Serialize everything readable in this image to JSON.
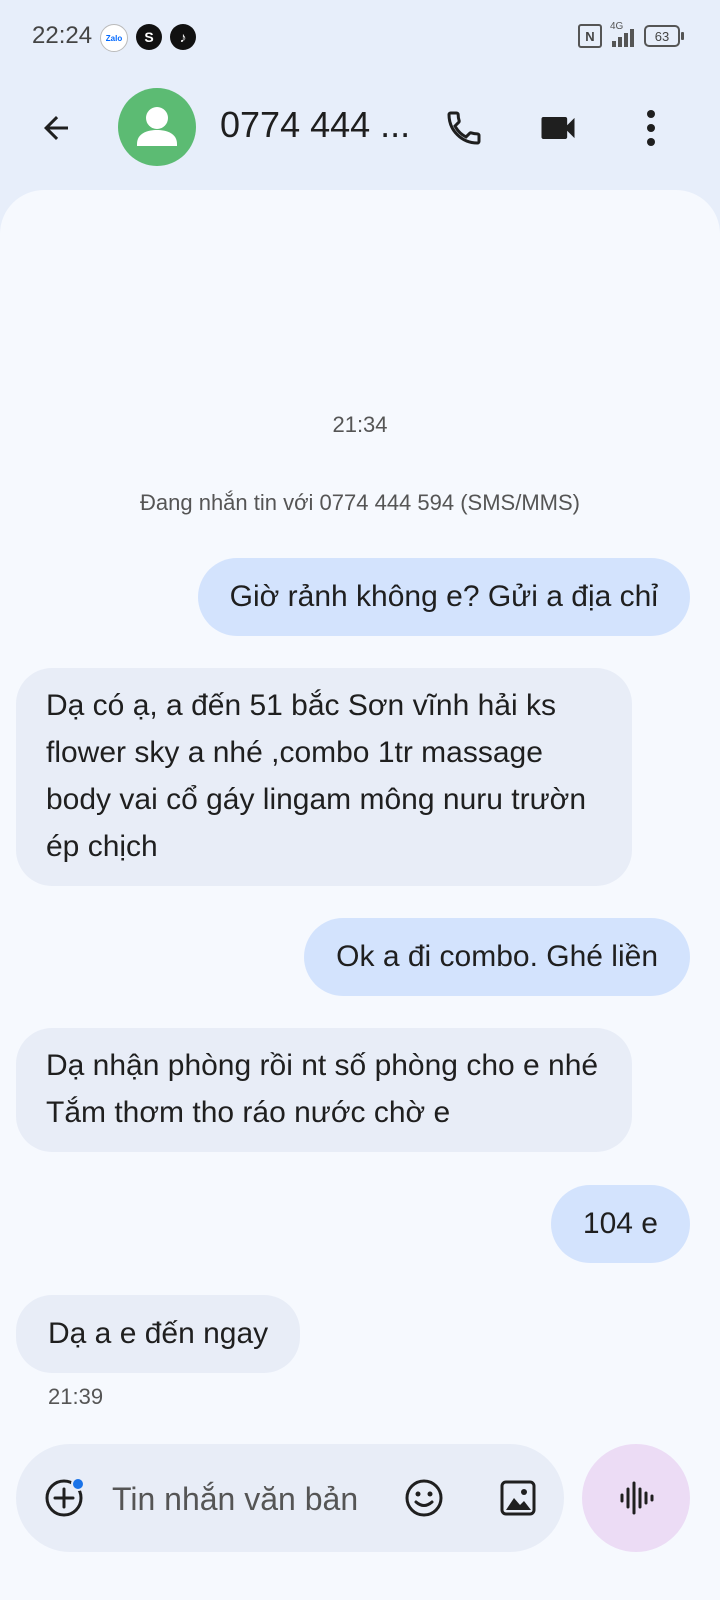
{
  "status_bar": {
    "time": "22:24",
    "app_icons": [
      "zalo-icon",
      "s-app-icon",
      "tiktok-icon"
    ],
    "zalo_label": "Zalo",
    "s_label": "S",
    "network_type": "4G",
    "nfc_label": "N",
    "battery": "63"
  },
  "header": {
    "contact_name": "0774 444 ...",
    "avatar_color": "#5cbb73"
  },
  "conversation": {
    "timestamp_top": "21:34",
    "info_line": "Đang nhắn tin với 0774 444 594 (SMS/MMS)",
    "messages": [
      {
        "direction": "outgoing",
        "text": "Giờ rảnh không e? Gửi a địa chỉ"
      },
      {
        "direction": "incoming",
        "text": "Dạ có ạ, a đến 51 bắc Sơn vĩnh hải ks flower sky a nhé ,combo 1tr massage body vai cổ gáy lingam mông nuru trườn ép chịch"
      },
      {
        "direction": "outgoing",
        "text": "Ok a đi combo. Ghé liền"
      },
      {
        "direction": "incoming",
        "text": "Dạ nhận phòng rồi nt số phòng cho e nhé Tắm thơm tho ráo nước chờ e"
      },
      {
        "direction": "outgoing",
        "text": "104 e"
      },
      {
        "direction": "incoming",
        "text": "Dạ a e đến ngay"
      }
    ],
    "timestamp_last": "21:39"
  },
  "compose": {
    "placeholder": "Tin nhắn văn bản",
    "value": ""
  },
  "colors": {
    "background": "#e7eefa",
    "outgoing_bubble": "#d3e3fd",
    "incoming_bubble": "#e8edf7",
    "voice_button": "#ecdcf5"
  }
}
